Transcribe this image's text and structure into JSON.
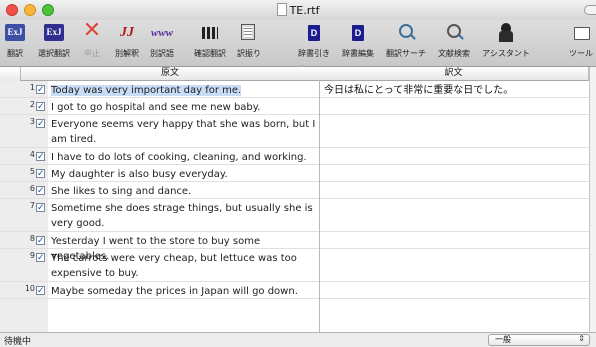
{
  "window": {
    "title": "TE.rtf"
  },
  "toolbar": {
    "items": [
      {
        "label": "翻訳",
        "icon": "exj-translate-icon"
      },
      {
        "label": "選択翻訳",
        "icon": "exj-selection-translate-icon"
      },
      {
        "label": "中止",
        "icon": "stop-x-icon",
        "disabled": true
      },
      {
        "label": "別解釈",
        "icon": "alternate-interpretation-icon"
      },
      {
        "label": "別訳語",
        "icon": "alternate-word-icon"
      },
      {
        "label": "確認翻訳",
        "icon": "confirm-translation-icon"
      },
      {
        "label": "訳振り",
        "icon": "interlinear-icon"
      },
      {
        "label": "辞書引き",
        "icon": "dictionary-lookup-icon"
      },
      {
        "label": "辞書編集",
        "icon": "dictionary-edit-icon"
      },
      {
        "label": "翻訳サーチ",
        "icon": "translation-search-icon"
      },
      {
        "label": "文献検索",
        "icon": "document-search-icon"
      },
      {
        "label": "アシスタント",
        "icon": "assistant-icon"
      },
      {
        "label": "ツール",
        "icon": "tools-icon"
      }
    ]
  },
  "table": {
    "headers": {
      "source": "原文",
      "target": "訳文"
    },
    "rows": [
      {
        "num": "1",
        "checked": true,
        "source": "Today was very important day for me.",
        "target": "今日は私にとって非常に重要な日でした。",
        "selected": true
      },
      {
        "num": "2",
        "checked": true,
        "source": "I got to go hospital and see me new baby.",
        "target": ""
      },
      {
        "num": "3",
        "checked": true,
        "source": "Everyone seems very happy that she was born, but I am tired.",
        "target": ""
      },
      {
        "num": "4",
        "checked": true,
        "source": "I have to do lots of cooking, cleaning, and working.",
        "target": ""
      },
      {
        "num": "5",
        "checked": true,
        "source": "My daughter is also busy everyday.",
        "target": ""
      },
      {
        "num": "6",
        "checked": true,
        "source": "She likes to sing and dance.",
        "target": ""
      },
      {
        "num": "7",
        "checked": true,
        "source": "Sometime she does strage things, but usually she is very good.",
        "target": ""
      },
      {
        "num": "8",
        "checked": true,
        "source": "Yesterday I went to the store to buy some vegetables.",
        "target": ""
      },
      {
        "num": "9",
        "checked": true,
        "source": "The carrots were very cheap, but lettuce was too expensive to buy.",
        "target": ""
      },
      {
        "num": "10",
        "checked": true,
        "source": "Maybe someday the prices in Japan will go down.",
        "target": ""
      }
    ]
  },
  "status": {
    "text": "待機中",
    "mode_value": "一般"
  },
  "glyphs": {
    "check": "✓",
    "arrows": "⇕"
  },
  "colors": {
    "selection": "#c9dcf5",
    "checkbox": "#1a4ea8"
  }
}
